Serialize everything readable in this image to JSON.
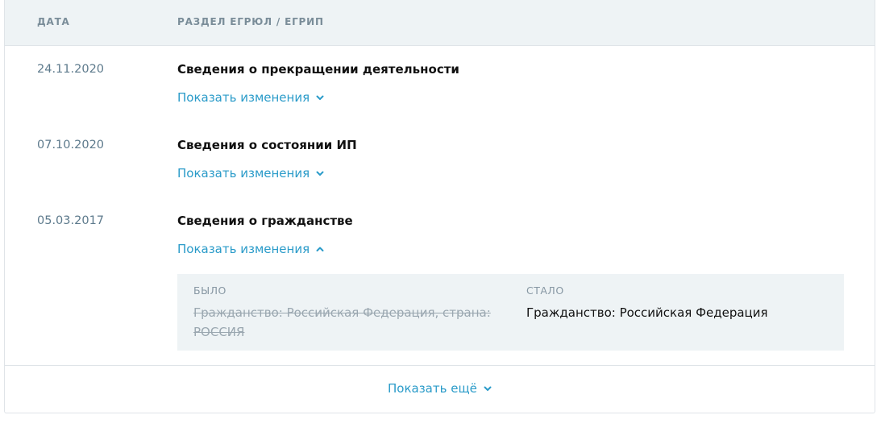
{
  "header": {
    "date_label": "ДАТА",
    "section_label": "РАЗДЕЛ ЕГРЮЛ / ЕГРИП"
  },
  "rows": [
    {
      "date": "24.11.2020",
      "title": "Сведения о прекращении деятельности",
      "toggle": "Показать изменения",
      "expanded": false
    },
    {
      "date": "07.10.2020",
      "title": "Сведения о состоянии ИП",
      "toggle": "Показать изменения",
      "expanded": false
    },
    {
      "date": "05.03.2017",
      "title": "Сведения о гражданстве",
      "toggle": "Показать изменения",
      "expanded": true
    }
  ],
  "diff": {
    "was_label": "БЫЛО",
    "now_label": "СТАЛО",
    "was_text": "Гражданство: Российская Федерация, страна: РОССИЯ",
    "now_text": "Гражданство: Российская Федерация"
  },
  "footer": {
    "show_more": "Показать ещё"
  },
  "colors": {
    "link": "#2a9bc9",
    "header_bg": "#eef3f5",
    "date": "#5d7a8c"
  },
  "icons": {
    "collapsed": "chevron-down-icon",
    "expanded": "chevron-up-icon"
  }
}
